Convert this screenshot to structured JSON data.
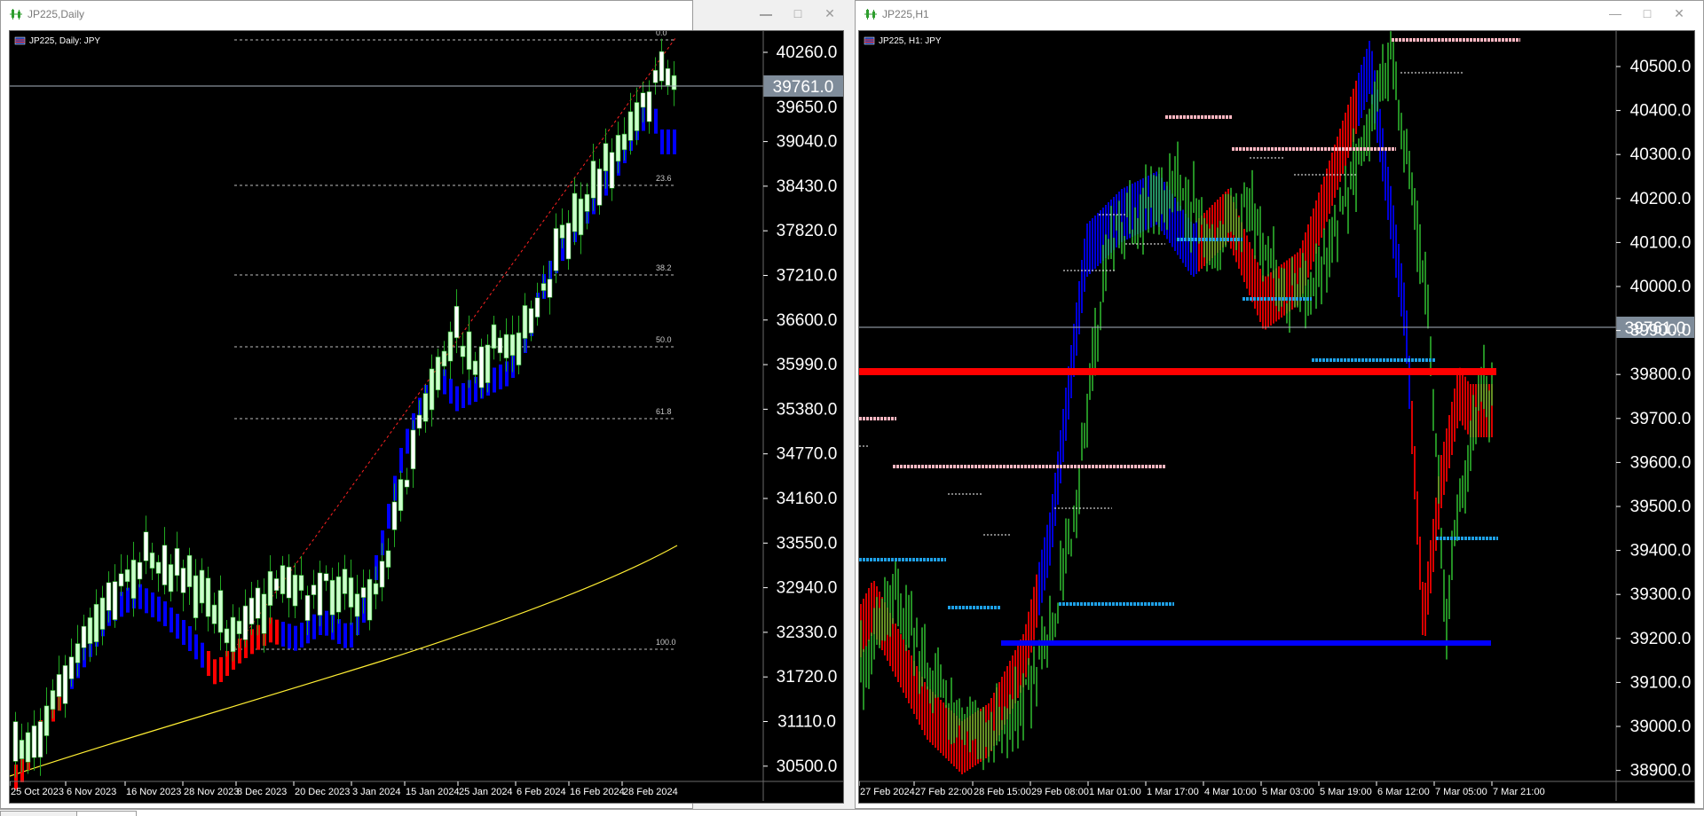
{
  "colors": {
    "bull": "#ccffcc",
    "bear": "#ffffff",
    "wick": "#22aa22",
    "blue": "#0000ff",
    "red": "#ff0000",
    "yellow": "#ffee33",
    "pink": "#ffb6c1",
    "cyan": "#1ea0e6",
    "price_box": "#7f8c9a"
  },
  "left_window": {
    "title": "JP225,Daily",
    "chart_label": "JP225, Daily: JPY",
    "current_price": "39761.0",
    "price_axis": [
      "40260.0",
      "39650.0",
      "39040.0",
      "38430.0",
      "37820.0",
      "37210.0",
      "36600.0",
      "35990.0",
      "35380.0",
      "34770.0",
      "34160.0",
      "33550.0",
      "32940.0",
      "32330.0",
      "31720.0",
      "31110.0",
      "30500.0"
    ],
    "time_axis": [
      "25 Oct 2023",
      "6 Nov 2023",
      "16 Nov 2023",
      "28 Nov 2023",
      "8 Dec 2023",
      "20 Dec 2023",
      "3 Jan 2024",
      "15 Jan 2024",
      "25 Jan 2024",
      "6 Feb 2024",
      "16 Feb 2024",
      "28 Feb 2024"
    ],
    "fib_levels": [
      "0.0",
      "23.6",
      "38.2",
      "50.0",
      "61.8",
      "100.0"
    ]
  },
  "right_window": {
    "title": "JP225,H1",
    "chart_label": "JP225, H1: JPY",
    "current_price": "39761.0",
    "price_axis": [
      "40500.0",
      "40400.0",
      "40300.0",
      "40200.0",
      "40100.0",
      "40000.0",
      "39900.0",
      "39800.0",
      "39700.0",
      "39600.0",
      "39500.0",
      "39400.0",
      "39300.0",
      "39200.0",
      "39100.0",
      "39000.0",
      "38900.0"
    ],
    "time_axis": [
      "27 Feb 2024",
      "27 Feb 22:00",
      "28 Feb 15:00",
      "29 Feb 08:00",
      "1 Mar 01:00",
      "1 Mar 17:00",
      "4 Mar 10:00",
      "5 Mar 03:00",
      "5 Mar 19:00",
      "6 Mar 12:00",
      "7 Mar 05:00",
      "7 Mar 21:00"
    ]
  },
  "window_buttons": {
    "minimize": "—",
    "maximize": "□",
    "close": "✕"
  }
}
